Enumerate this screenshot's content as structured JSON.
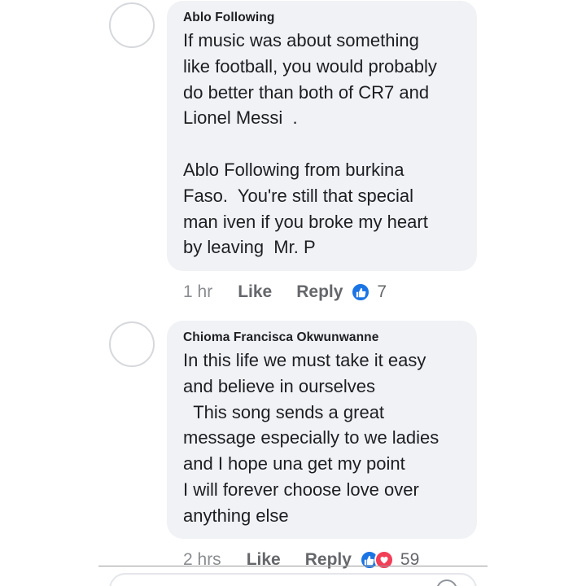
{
  "comments": [
    {
      "author": "Ablo Following",
      "text": "If music was about something\nlike football, you would probably\ndo better than both of CR7 and\nLionel Messi  .\n\nAblo Following from burkina\nFaso.  You're still that special\nman iven if you broke my heart\nby leaving  Mr. P",
      "time": "1 hr",
      "like_label": "Like",
      "reply_label": "Reply",
      "reaction_count": "7",
      "reactions": [
        "like-icon"
      ]
    },
    {
      "author": "Chioma Francisca Okwunwanne",
      "text": "In this life we must take it easy\nand believe in ourselves\n  This song sends a great\nmessage especially to we ladies\nand I hope una get my point\nI will forever choose love over\nanything else",
      "time": "2 hrs",
      "like_label": "Like",
      "reply_label": "Reply",
      "reaction_count": "59",
      "reactions": [
        "like-icon",
        "love-icon"
      ]
    }
  ],
  "colors": {
    "bubble": "#f0f2f5",
    "like_blue": "#1b74e4",
    "love_red": "#f33e58",
    "meta_gray": "#65676b"
  }
}
